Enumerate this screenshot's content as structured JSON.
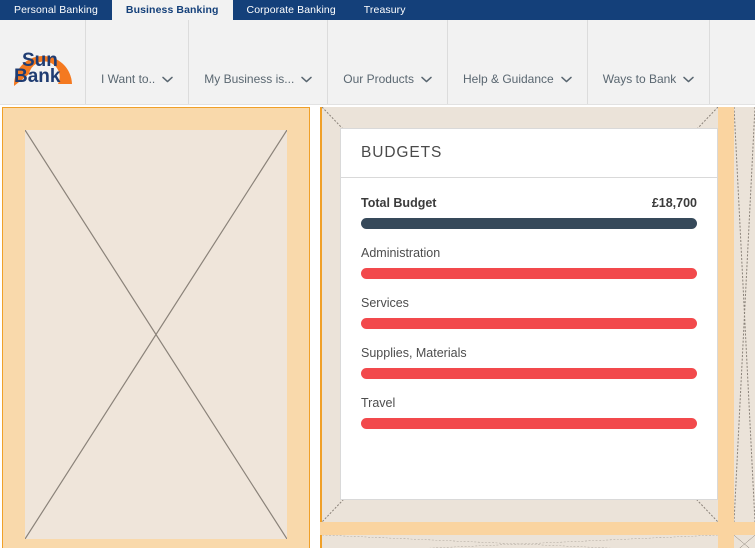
{
  "topnav": {
    "tabs": [
      {
        "label": "Personal Banking",
        "active": false
      },
      {
        "label": "Business Banking",
        "active": true
      },
      {
        "label": "Corporate Banking",
        "active": false
      },
      {
        "label": "Treasury",
        "active": false
      }
    ]
  },
  "brand": {
    "logo_line1": "Sun",
    "logo_line2": "Bank",
    "logo_arc_color": "#F47920",
    "logo_text_color": "#1F3C72"
  },
  "mainmenu": {
    "items": [
      {
        "label": "I Want to..",
        "icon": "chevron-down-icon"
      },
      {
        "label": "My Business is...",
        "icon": "chevron-down-icon"
      },
      {
        "label": "Our Products",
        "icon": "chevron-down-icon"
      },
      {
        "label": "Help & Guidance",
        "icon": "chevron-down-icon"
      },
      {
        "label": "Ways to Bank",
        "icon": "chevron-down-icon"
      }
    ]
  },
  "budgets_card": {
    "title": "BUDGETS",
    "total": {
      "label": "Total Budget",
      "amount": "£18,700",
      "bar_percent": 100,
      "bar_color": "#36495A"
    },
    "categories": [
      {
        "label": "Administration",
        "bar_percent": 100,
        "bar_color": "#F2494C"
      },
      {
        "label": "Services",
        "bar_percent": 100,
        "bar_color": "#F2494C"
      },
      {
        "label": "Supplies, Materials",
        "bar_percent": 100,
        "bar_color": "#F2494C"
      },
      {
        "label": "Travel",
        "bar_percent": 100,
        "bar_color": "#F2494C"
      }
    ]
  },
  "theme": {
    "nav_navy": "#14407A",
    "active_tab_bg": "#F2F2F2",
    "placeholder_peach": "#F9D9AB",
    "placeholder_border": "#F0A028",
    "wire_cell_beige": "#EBE3D9",
    "wire_gutter": "#FAD4A0"
  }
}
